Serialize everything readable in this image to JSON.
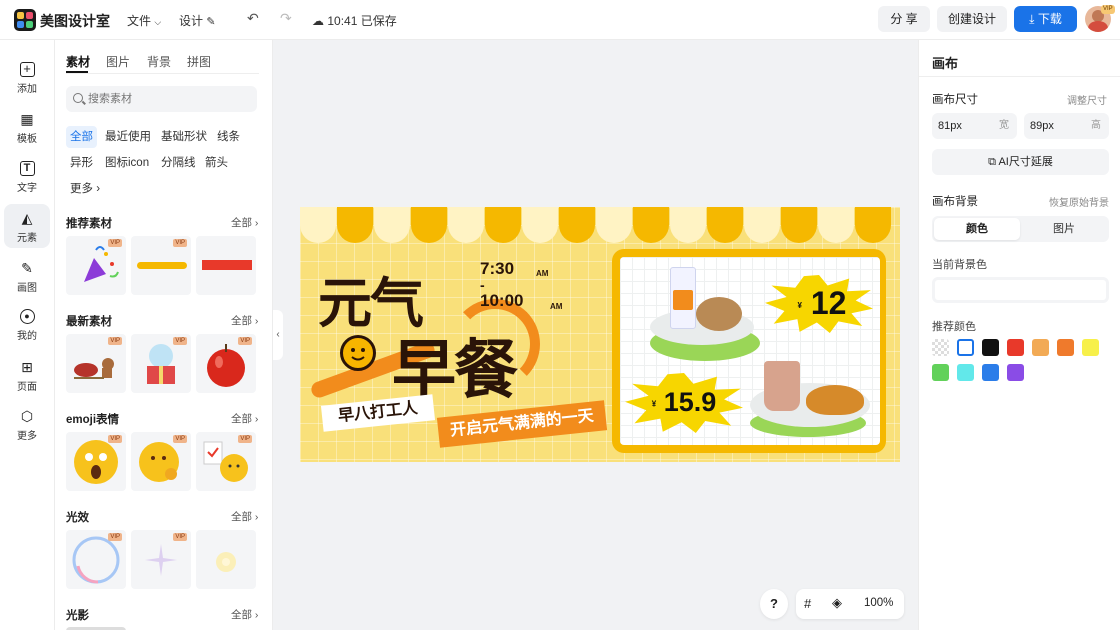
{
  "topbar": {
    "brand": "美图设计室",
    "file_menu": "文件",
    "design_menu": "设计",
    "save_status": "10:41 已保存",
    "share_label": "分 享",
    "create_label": "创建设计",
    "download_label": "下载",
    "vip_badge": "VIP"
  },
  "rail": [
    {
      "label": "添加",
      "icon": "plus-icon"
    },
    {
      "label": "模板",
      "icon": "template-icon"
    },
    {
      "label": "文字",
      "icon": "text-icon"
    },
    {
      "label": "元素",
      "icon": "shapes-icon"
    },
    {
      "label": "画图",
      "icon": "draw-icon"
    },
    {
      "label": "我的",
      "icon": "user-icon"
    },
    {
      "label": "页面",
      "icon": "page-add-icon"
    },
    {
      "label": "更多",
      "icon": "cube-icon"
    }
  ],
  "panel": {
    "tabs": [
      "素材",
      "图片",
      "背景",
      "拼图"
    ],
    "search_placeholder": "搜索素材",
    "chips": [
      "全部",
      "最近使用",
      "基础形状",
      "线条",
      "异形",
      "图标icon",
      "分隔线",
      "箭头",
      "更多"
    ],
    "all_label": "全部",
    "vip_label": "VIP",
    "sections": [
      {
        "title": "推荐素材"
      },
      {
        "title": "最新素材"
      },
      {
        "title": "emoji表情"
      },
      {
        "title": "光效"
      },
      {
        "title": "光影"
      }
    ]
  },
  "canvas": {
    "title_line1": "元气",
    "title_line2": "早餐",
    "time_start": "7:30",
    "time_dash": "-",
    "time_end": "10:00",
    "am1": "AM",
    "am2": "AM",
    "slogan1": "早八打工人",
    "slogan2": "开启元气满满的一天",
    "price1": "12",
    "price2": "15.9",
    "currency": "¥",
    "colors": {
      "bg": "#f9e07a",
      "awning": "#f5b800",
      "awning_light": "#fff3c4",
      "dark": "#2a1408",
      "orange": "#f28c1c"
    }
  },
  "bottom": {
    "help": "?",
    "zoom": "100%"
  },
  "right": {
    "title": "画布",
    "size_label": "画布尺寸",
    "resize_link": "调整尺寸",
    "width_value": "81px",
    "width_unit": "宽",
    "height_value": "89px",
    "height_unit": "高",
    "ai_button": "AI尺寸延展",
    "bg_label": "画布背景",
    "restore_link": "恢复原始背景",
    "seg_color": "颜色",
    "seg_image": "图片",
    "current_bg_label": "当前背景色",
    "recommend_label": "推荐颜色",
    "swatches": [
      "transparent",
      "#ffffff",
      "#111111",
      "#e8392a",
      "#f2aa55",
      "#ef7a2c",
      "#f7f04a",
      "#62d15a",
      "#62e8ea",
      "#2b7de9",
      "#8a4ce6"
    ]
  }
}
